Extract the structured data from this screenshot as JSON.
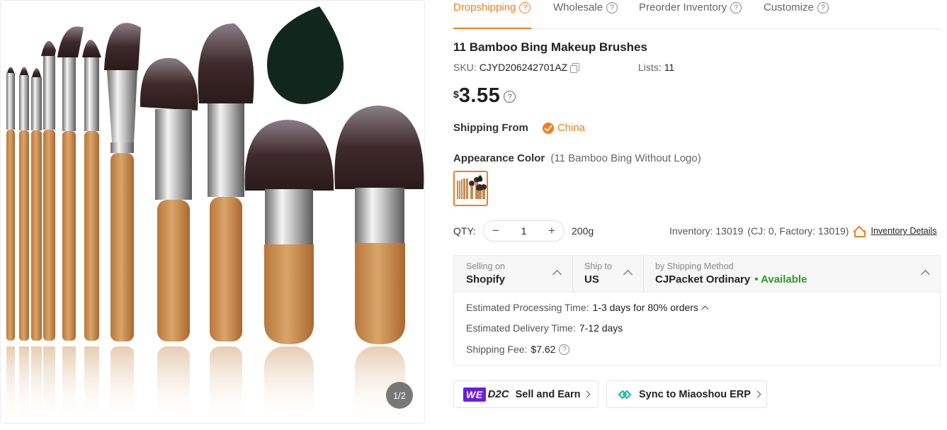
{
  "gallery": {
    "pager": "1/2"
  },
  "tabs": [
    {
      "label": "Dropshipping",
      "active": true
    },
    {
      "label": "Wholesale",
      "active": false
    },
    {
      "label": "Preorder Inventory",
      "active": false
    },
    {
      "label": "Customize",
      "active": false
    }
  ],
  "product": {
    "title": "11 Bamboo Bing Makeup Brushes",
    "sku_label": "SKU:",
    "sku": "CJYD206242701AZ",
    "lists_label": "Lists:",
    "lists": "11",
    "currency": "$",
    "price": "3.55"
  },
  "shipping_from": {
    "label": "Shipping From",
    "country": "China"
  },
  "appearance": {
    "label": "Appearance Color",
    "selected": "(11 Bamboo Bing Without Logo)"
  },
  "quantity": {
    "label": "QTY:",
    "minus": "−",
    "value": "1",
    "plus": "+",
    "weight": "200g",
    "inventory": "Inventory: 13019",
    "inventory_breakdown": "(CJ: 0, Factory: 13019)",
    "inventory_link": "Inventory Details"
  },
  "shipping": {
    "selling_on_label": "Selling on",
    "selling_on": "Shopify",
    "ship_to_label": "Ship to",
    "ship_to": "US",
    "method_label": "by Shipping Method",
    "method": "CJPacket Ordinary",
    "availability": "• Available",
    "processing_label": "Estimated Processing Time:",
    "processing": "1-3 days for 80% orders",
    "delivery_label": "Estimated Delivery Time:",
    "delivery": "7-12 days",
    "fee_label": "Shipping Fee:",
    "fee": "$7.62"
  },
  "actions": {
    "we_logo": "WE",
    "d2c_logo": "D2C",
    "sell_earn": "Sell and Earn",
    "sync": "Sync to Miaoshou ERP"
  },
  "colors": {
    "accent": "#f57c1f",
    "available": "#2e9a2e",
    "we_purple": "#6a1fe0"
  }
}
